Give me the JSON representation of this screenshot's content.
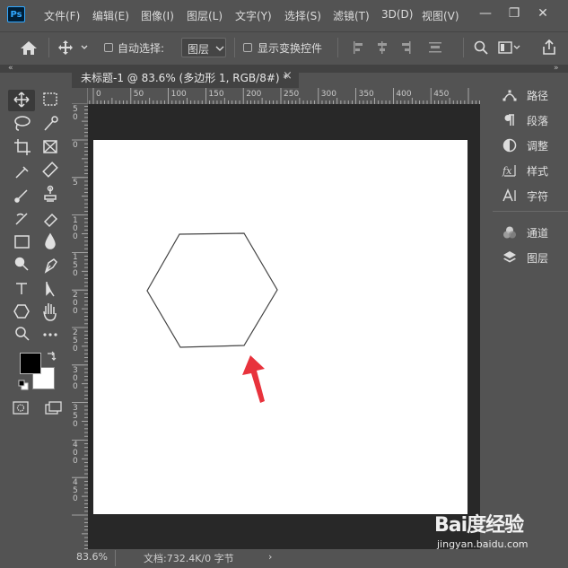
{
  "app": {
    "logo": "Ps"
  },
  "menu": [
    "文件(F)",
    "编辑(E)",
    "图像(I)",
    "图层(L)",
    "文字(Y)",
    "选择(S)",
    "滤镜(T)",
    "3D(D)",
    "视图(V)"
  ],
  "window_controls": {
    "minimize": "—",
    "restore": "❐",
    "close": "✕"
  },
  "options_bar": {
    "auto_select_label": "自动选择:",
    "auto_select_value": "图层",
    "show_transform_label": "显示变换控件"
  },
  "document": {
    "tab_title": "未标题-1 @ 83.6% (多边形 1, RGB/8#) *",
    "close": "×"
  },
  "rulers": {
    "horizontal": [
      "0",
      "50",
      "100",
      "150",
      "200",
      "250",
      "300",
      "350",
      "400",
      "450"
    ],
    "vertical": [
      "0",
      "5",
      "1\n0\n0",
      "1\n5\n0",
      "2\n0\n0",
      "2\n5\n0",
      "3\n0\n0",
      "3\n5\n0",
      "4\n0\n0",
      "4\n5\n0"
    ]
  },
  "status": {
    "zoom": "83.6%",
    "doc_info": "文档:732.4K/0 字节",
    "arrow": "›"
  },
  "panels": [
    {
      "icon": "path-icon",
      "label": "路径"
    },
    {
      "icon": "paragraph-icon",
      "label": "段落"
    },
    {
      "icon": "adjustments-icon",
      "label": "调整"
    },
    {
      "icon": "styles-icon",
      "label": "样式"
    },
    {
      "icon": "character-icon",
      "label": "字符"
    },
    {
      "icon": "channels-icon",
      "label": "通道"
    },
    {
      "icon": "layers-icon",
      "label": "图层"
    }
  ],
  "colors": {
    "foreground": "#000000",
    "background": "#ffffff",
    "annotation_arrow": "#e8323c",
    "ui_bg": "#535353",
    "pasteboard": "#282828"
  },
  "watermark": {
    "logo": "Bai度经验",
    "url": "jingyan.baidu.com"
  }
}
